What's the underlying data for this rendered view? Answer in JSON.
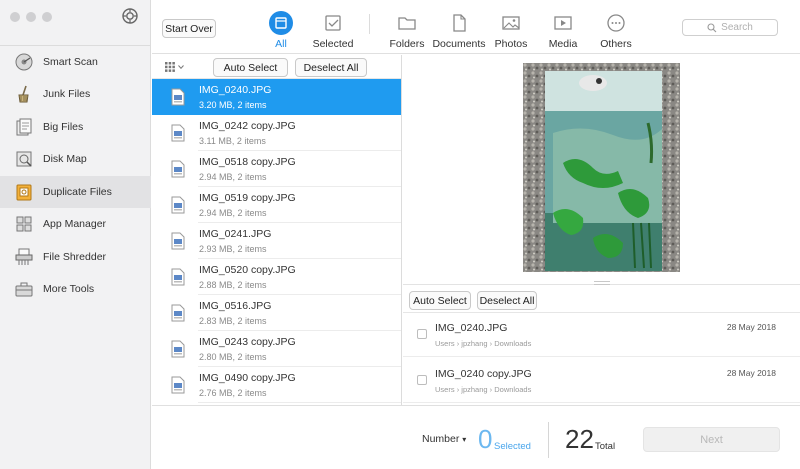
{
  "sidebar": {
    "items": [
      {
        "label": "Smart Scan",
        "icon": "disk-scan-icon"
      },
      {
        "label": "Junk Files",
        "icon": "broom-icon"
      },
      {
        "label": "Big Files",
        "icon": "big-files-icon"
      },
      {
        "label": "Disk Map",
        "icon": "disk-map-icon"
      },
      {
        "label": "Duplicate Files",
        "icon": "duplicate-files-icon",
        "active": true
      },
      {
        "label": "App Manager",
        "icon": "app-manager-icon"
      },
      {
        "label": "File Shredder",
        "icon": "shredder-icon"
      },
      {
        "label": "More Tools",
        "icon": "toolbox-icon"
      }
    ]
  },
  "toolbar": {
    "start_over": "Start Over",
    "categories": [
      {
        "label": "All",
        "icon": "all-files-icon",
        "active": true
      },
      {
        "label": "Selected",
        "icon": "selected-icon"
      },
      {
        "label": "Folders",
        "icon": "folder-icon"
      },
      {
        "label": "Documents",
        "icon": "documents-icon"
      },
      {
        "label": "Photos",
        "icon": "photos-icon"
      },
      {
        "label": "Media",
        "icon": "media-icon"
      },
      {
        "label": "Others",
        "icon": "others-icon"
      }
    ],
    "search_placeholder": "Search"
  },
  "list": {
    "auto_select": "Auto Select",
    "deselect_all": "Deselect All",
    "files": [
      {
        "name": "IMG_0240.JPG",
        "meta": "3.20 MB, 2 items",
        "selected": true
      },
      {
        "name": "IMG_0242 copy.JPG",
        "meta": "3.11 MB, 2 items"
      },
      {
        "name": "IMG_0518 copy.JPG",
        "meta": "2.94 MB, 2 items"
      },
      {
        "name": "IMG_0519 copy.JPG",
        "meta": "2.94 MB, 2 items"
      },
      {
        "name": "IMG_0241.JPG",
        "meta": "2.93 MB, 2 items"
      },
      {
        "name": "IMG_0520 copy.JPG",
        "meta": "2.88 MB, 2 items"
      },
      {
        "name": "IMG_0516.JPG",
        "meta": "2.83 MB, 2 items"
      },
      {
        "name": "IMG_0243 copy.JPG",
        "meta": "2.80 MB, 2 items"
      },
      {
        "name": "IMG_0490 copy.JPG",
        "meta": "2.76 MB, 2 items"
      }
    ]
  },
  "duplicates": {
    "auto_select": "Auto Select",
    "deselect_all": "Deselect All",
    "items": [
      {
        "name": "IMG_0240.JPG",
        "date": "28 May 2018",
        "path": [
          "Users",
          "jpzhang",
          "Downloads"
        ]
      },
      {
        "name": "IMG_0240 copy.JPG",
        "date": "28 May 2018",
        "path": [
          "Users",
          "jpzhang",
          "Downloads"
        ]
      }
    ]
  },
  "footer": {
    "sort_label": "Number",
    "selected_count": "0",
    "selected_label": "Selected",
    "total_count": "22",
    "total_label": "Total",
    "next_label": "Next"
  },
  "colors": {
    "accent": "#1f9bf0",
    "sidebar_bg": "#f2f2f3",
    "active_item_bg": "#e2e2e4"
  }
}
